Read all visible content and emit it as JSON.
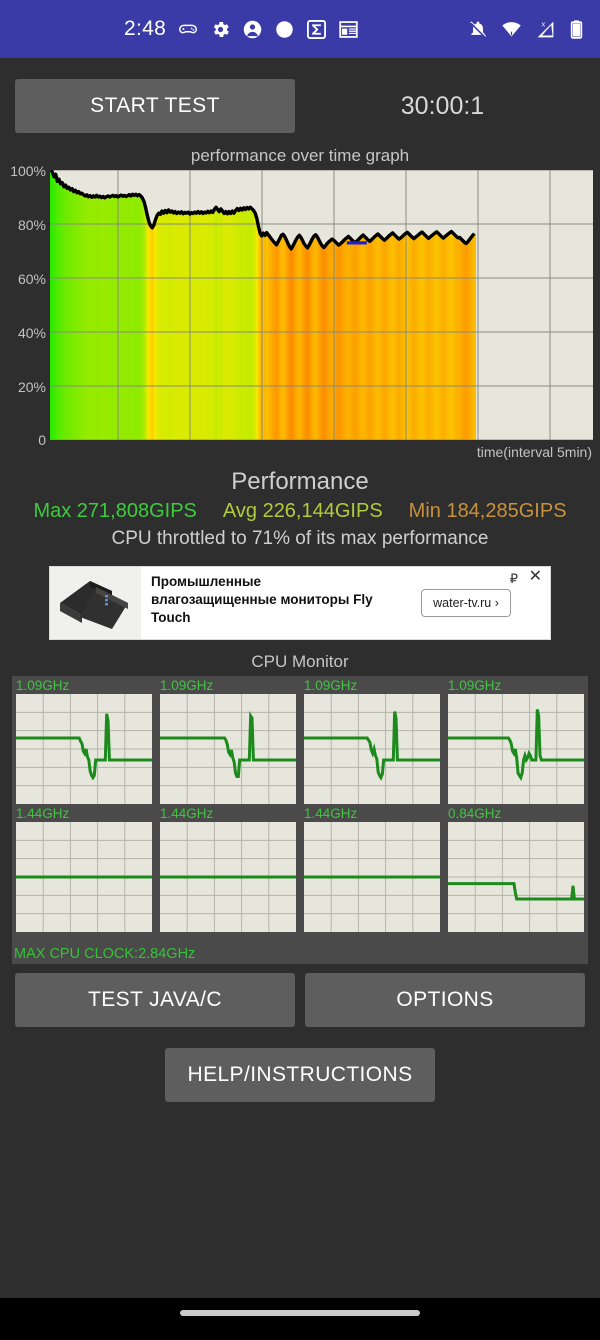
{
  "statusbar": {
    "background": "#3b3ba8",
    "clock": "2:48",
    "left_icons": [
      "gamepad-icon",
      "gear-icon",
      "account-icon",
      "circle-icon",
      "sigma-icon",
      "calendar-icon"
    ],
    "right_icons": [
      "notifications-muted-icon",
      "wifi-icon",
      "signal-no-sim-icon",
      "battery-icon"
    ]
  },
  "toolbar": {
    "start_test_label": "START TEST",
    "timer": "30:00:1"
  },
  "graph": {
    "title": "performance over time graph",
    "xlabel": "time(interval 5min)",
    "ytick_labels": [
      "100%",
      "80%",
      "60%",
      "40%",
      "20%",
      "0"
    ]
  },
  "performance": {
    "heading": "Performance",
    "max_label": "Max 271,808GIPS",
    "avg_label": "Avg 226,144GIPS",
    "min_label": "Min 184,285GIPS",
    "max_color": "#3fcb3f",
    "avg_color": "#b0cb3b",
    "min_color": "#c8913c",
    "throttle_note": "CPU throttled to 71% of its max performance"
  },
  "ad": {
    "headline": "Промышленные влагозащищенные мониторы Fly Touch",
    "cta": "water-tv.ru ›",
    "currency_marker": "₽",
    "close_label": "✕"
  },
  "cpu_monitor": {
    "title": "CPU Monitor",
    "cores": [
      {
        "freq": "1.09GHz",
        "chart": "core0"
      },
      {
        "freq": "1.09GHz",
        "chart": "core1"
      },
      {
        "freq": "1.09GHz",
        "chart": "core2"
      },
      {
        "freq": "1.09GHz",
        "chart": "core3"
      },
      {
        "freq": "1.44GHz",
        "chart": "core4"
      },
      {
        "freq": "1.44GHz",
        "chart": "core5"
      },
      {
        "freq": "1.44GHz",
        "chart": "core6"
      },
      {
        "freq": "0.84GHz",
        "chart": "core7"
      }
    ],
    "max_clock": "MAX CPU CLOCK:2.84GHz"
  },
  "buttons": {
    "test_java_c": "TEST JAVA/C",
    "options": "OPTIONS",
    "help": "HELP/INSTRUCTIONS"
  },
  "chart_data": {
    "type": "line",
    "title": "performance over time graph",
    "xlabel": "time(interval 5min)",
    "ylabel": "",
    "ylim": [
      0,
      100
    ],
    "ytick_labels": [
      "100%",
      "80%",
      "60%",
      "40%",
      "20%",
      "0"
    ],
    "yticks": [
      100,
      80,
      60,
      40,
      20,
      0
    ],
    "grid": true,
    "legend": "none",
    "series": [
      {
        "name": "performance %",
        "values": [
          100,
          99.2,
          97.5,
          98.4,
          95.8,
          96.6,
          94.9,
          95.3,
          93.8,
          94.4,
          93.2,
          93.6,
          92.6,
          93.1,
          92.0,
          92.5,
          91.6,
          92.0,
          91.2,
          91.4,
          90.8,
          90.4,
          90.8,
          90.1,
          90.5,
          89.9,
          90.4,
          90.0,
          90.6,
          90.0,
          90.3,
          89.8,
          90.2,
          89.7,
          90.1,
          90.4,
          90.0,
          90.3,
          90.6,
          90.2,
          90.5,
          90.0,
          90.4,
          90.7,
          90.3,
          90.6,
          90.2,
          90.5,
          90.9,
          90.4,
          91.0,
          90.6,
          91.0,
          90.5,
          90.9,
          90.4,
          89.6,
          88.3,
          86.0,
          83.2,
          80.8,
          79.3,
          78.6,
          79.6,
          81.6,
          83.2,
          84.0,
          83.6,
          84.8,
          84.0,
          85.0,
          84.2,
          85.2,
          84.4,
          84.8,
          84.1,
          84.6,
          83.9,
          84.4,
          84.0,
          84.5,
          83.8,
          84.3,
          84.0,
          84.4,
          83.7,
          84.2,
          83.9,
          84.4,
          84.0,
          84.6,
          84.0,
          84.5,
          83.9,
          84.4,
          84.1,
          84.7,
          84.2,
          84.8,
          84.3,
          85.4,
          86.2,
          85.4,
          84.6,
          85.6,
          84.8,
          83.9,
          84.6,
          83.8,
          84.6,
          83.9,
          84.8,
          84.0,
          85.0,
          85.7,
          85.0,
          85.8,
          85.2,
          86.0,
          85.4,
          86.1,
          85.6,
          86.2,
          85.6,
          85.0,
          84.0,
          82.0,
          79.0,
          76.5,
          75.6,
          76.6,
          75.8,
          76.8,
          76.0,
          75.2,
          74.4,
          73.6,
          73.0,
          72.3,
          73.4,
          74.6,
          75.8,
          76.2,
          75.4,
          74.2,
          72.8,
          71.6,
          70.8,
          71.8,
          73.0,
          74.2,
          75.2,
          75.8,
          75.0,
          73.8,
          72.6,
          71.8,
          71.2,
          72.2,
          73.4,
          74.6,
          75.6,
          76.0,
          75.2,
          74.0,
          72.8,
          71.9,
          71.3,
          72.0,
          72.8,
          73.4,
          73.9,
          74.4,
          74.0,
          73.4,
          72.8,
          72.2,
          72.6,
          73.2,
          73.8,
          74.4,
          74.9,
          75.4,
          74.8,
          74.2,
          73.6,
          73.1,
          73.6,
          74.2,
          74.8,
          75.4,
          75.9,
          75.3,
          74.7,
          74.1,
          73.6,
          74.1,
          74.7,
          75.3,
          75.8,
          76.3,
          75.7,
          75.1,
          74.5,
          74.0,
          74.5,
          75.1,
          75.7,
          76.2,
          76.7,
          76.1,
          75.5,
          74.9,
          74.4,
          74.9,
          75.4,
          76.0,
          76.5,
          76.9,
          76.3,
          75.7,
          75.1,
          74.6,
          75.1,
          75.6,
          76.1,
          76.6,
          77.0,
          76.4,
          75.8,
          75.2,
          74.7,
          75.2,
          75.7,
          76.2,
          76.7,
          77.1,
          76.5,
          75.9,
          75.3,
          74.8,
          75.3,
          75.8,
          76.3,
          76.8,
          77.2,
          76.6,
          76.0,
          75.4,
          74.9,
          75.0,
          74.4,
          73.8,
          73.2,
          72.8,
          73.4,
          74.2,
          75.0,
          75.8,
          76.4
        ]
      }
    ],
    "annotations": [
      {
        "label": "max-marker",
        "color": "#1f1fcf",
        "x_frac": 0.565,
        "y": 73.0
      }
    ],
    "heatmap_note": "background vertical bands shade green(fast)->yellow/orange(slow) per sample",
    "data_end_fraction": 0.783
  },
  "cpu_charts": {
    "core0": [
      60,
      60,
      60,
      60,
      60,
      60,
      60,
      60,
      60,
      60,
      60,
      60,
      60,
      60,
      60,
      60,
      60,
      60,
      60,
      60,
      60,
      60,
      60,
      60,
      60,
      60,
      60,
      60,
      60,
      60,
      60,
      60,
      60,
      60,
      60,
      60,
      60,
      60,
      60,
      60,
      60,
      60,
      60,
      60,
      60,
      60,
      60,
      57,
      55,
      48,
      46,
      50,
      43,
      40,
      30,
      26,
      24,
      26,
      40,
      40,
      40,
      40,
      40,
      40,
      40,
      40,
      82,
      76,
      40,
      40,
      40,
      40,
      40,
      40,
      40,
      40,
      40,
      40,
      40,
      40,
      40,
      40,
      40,
      40,
      40,
      40,
      40,
      40,
      40,
      40,
      40,
      40,
      40,
      40,
      40,
      40,
      40,
      40,
      40,
      40
    ],
    "core1": [
      60,
      60,
      60,
      60,
      60,
      60,
      60,
      60,
      60,
      60,
      60,
      60,
      60,
      60,
      60,
      60,
      60,
      60,
      60,
      60,
      60,
      60,
      60,
      60,
      60,
      60,
      60,
      60,
      60,
      60,
      60,
      60,
      60,
      60,
      60,
      60,
      60,
      60,
      60,
      60,
      60,
      60,
      60,
      60,
      60,
      60,
      60,
      60,
      58,
      54,
      47,
      45,
      49,
      42,
      38,
      28,
      25,
      25,
      40,
      40,
      40,
      40,
      40,
      40,
      40,
      40,
      80,
      78,
      40,
      40,
      40,
      40,
      40,
      40,
      40,
      40,
      40,
      40,
      40,
      40,
      40,
      40,
      40,
      40,
      40,
      40,
      40,
      40,
      40,
      40,
      40,
      40,
      40,
      40,
      40,
      40,
      40,
      40,
      40,
      40
    ],
    "core2": [
      60,
      60,
      60,
      60,
      60,
      60,
      60,
      60,
      60,
      60,
      60,
      60,
      60,
      60,
      60,
      60,
      60,
      60,
      60,
      60,
      60,
      60,
      60,
      60,
      60,
      60,
      60,
      60,
      60,
      60,
      60,
      60,
      60,
      60,
      60,
      60,
      60,
      60,
      60,
      60,
      60,
      60,
      60,
      60,
      60,
      60,
      60,
      58,
      56,
      49,
      46,
      50,
      44,
      41,
      29,
      26,
      24,
      27,
      40,
      40,
      40,
      40,
      40,
      40,
      40,
      40,
      84,
      78,
      40,
      40,
      40,
      40,
      40,
      40,
      40,
      40,
      40,
      40,
      40,
      40,
      40,
      40,
      40,
      40,
      40,
      40,
      40,
      40,
      40,
      40,
      40,
      40,
      40,
      40,
      40,
      40,
      40,
      40,
      40,
      40
    ],
    "core3": [
      60,
      60,
      60,
      60,
      60,
      60,
      60,
      60,
      60,
      60,
      60,
      60,
      60,
      60,
      60,
      60,
      60,
      60,
      60,
      60,
      60,
      60,
      60,
      60,
      60,
      60,
      60,
      60,
      60,
      60,
      60,
      60,
      60,
      60,
      60,
      60,
      60,
      60,
      60,
      60,
      60,
      60,
      60,
      60,
      60,
      58,
      55,
      48,
      46,
      50,
      42,
      28,
      26,
      24,
      28,
      40,
      44,
      40,
      42,
      46,
      44,
      40,
      40,
      40,
      40,
      86,
      80,
      44,
      40,
      40,
      40,
      40,
      40,
      40,
      40,
      40,
      40,
      40,
      40,
      40,
      40,
      40,
      40,
      40,
      40,
      40,
      40,
      40,
      40,
      40,
      40,
      40,
      40,
      40,
      40,
      40,
      40,
      40,
      40,
      40
    ],
    "core4": [
      50,
      50,
      50,
      50,
      50,
      50,
      50,
      50,
      50,
      50,
      50,
      50,
      50,
      50,
      50,
      50,
      50,
      50,
      50,
      50,
      50,
      50,
      50,
      50,
      50,
      50,
      50,
      50,
      50,
      50,
      50,
      50,
      50,
      50,
      50,
      50,
      50,
      50,
      50,
      50,
      50,
      50,
      50,
      50,
      50,
      50,
      50,
      50,
      50,
      50,
      50,
      50,
      50,
      50,
      50,
      50,
      50,
      50,
      50,
      50,
      50,
      50,
      50,
      50,
      50,
      50,
      50,
      50,
      50,
      50,
      50,
      50,
      50,
      50,
      50,
      50,
      50,
      50,
      50,
      50,
      50,
      50,
      50,
      50,
      50,
      50,
      50,
      50,
      50,
      50,
      50,
      50,
      50,
      50,
      50,
      50,
      50,
      50,
      50,
      50
    ],
    "core5": [
      50,
      50,
      50,
      50,
      50,
      50,
      50,
      50,
      50,
      50,
      50,
      50,
      50,
      50,
      50,
      50,
      50,
      50,
      50,
      50,
      50,
      50,
      50,
      50,
      50,
      50,
      50,
      50,
      50,
      50,
      50,
      50,
      50,
      50,
      50,
      50,
      50,
      50,
      50,
      50,
      50,
      50,
      50,
      50,
      50,
      50,
      50,
      50,
      50,
      50,
      50,
      50,
      50,
      50,
      50,
      50,
      50,
      50,
      50,
      50,
      50,
      50,
      50,
      50,
      50,
      50,
      50,
      50,
      50,
      50,
      50,
      50,
      50,
      50,
      50,
      50,
      50,
      50,
      50,
      50,
      50,
      50,
      50,
      50,
      50,
      50,
      50,
      50,
      50,
      50,
      50,
      50,
      50,
      50,
      50,
      50,
      50,
      50,
      50,
      50
    ],
    "core6": [
      50,
      50,
      50,
      50,
      50,
      50,
      50,
      50,
      50,
      50,
      50,
      50,
      50,
      50,
      50,
      50,
      50,
      50,
      50,
      50,
      50,
      50,
      50,
      50,
      50,
      50,
      50,
      50,
      50,
      50,
      50,
      50,
      50,
      50,
      50,
      50,
      50,
      50,
      50,
      50,
      50,
      50,
      50,
      50,
      50,
      50,
      50,
      50,
      50,
      50,
      50,
      50,
      50,
      50,
      50,
      50,
      50,
      50,
      50,
      50,
      50,
      50,
      50,
      50,
      50,
      50,
      50,
      50,
      50,
      50,
      50,
      50,
      50,
      50,
      50,
      50,
      50,
      50,
      50,
      50,
      50,
      50,
      50,
      50,
      50,
      50,
      50,
      50,
      50,
      50,
      50,
      50,
      50,
      50,
      50,
      50,
      50,
      50,
      50,
      50
    ],
    "core7": [
      44,
      44,
      44,
      44,
      44,
      44,
      44,
      44,
      44,
      44,
      44,
      44,
      44,
      44,
      44,
      44,
      44,
      44,
      44,
      44,
      44,
      44,
      44,
      44,
      44,
      44,
      44,
      44,
      44,
      44,
      44,
      44,
      44,
      44,
      44,
      44,
      44,
      44,
      44,
      44,
      44,
      44,
      44,
      44,
      44,
      44,
      44,
      44,
      44,
      36,
      30,
      30,
      30,
      30,
      30,
      30,
      30,
      30,
      30,
      30,
      30,
      30,
      30,
      30,
      30,
      30,
      30,
      30,
      30,
      30,
      30,
      30,
      30,
      30,
      30,
      30,
      30,
      30,
      30,
      30,
      30,
      30,
      30,
      30,
      30,
      30,
      30,
      30,
      30,
      30,
      30,
      42,
      30,
      30,
      30,
      30,
      30,
      30,
      30,
      30
    ]
  }
}
